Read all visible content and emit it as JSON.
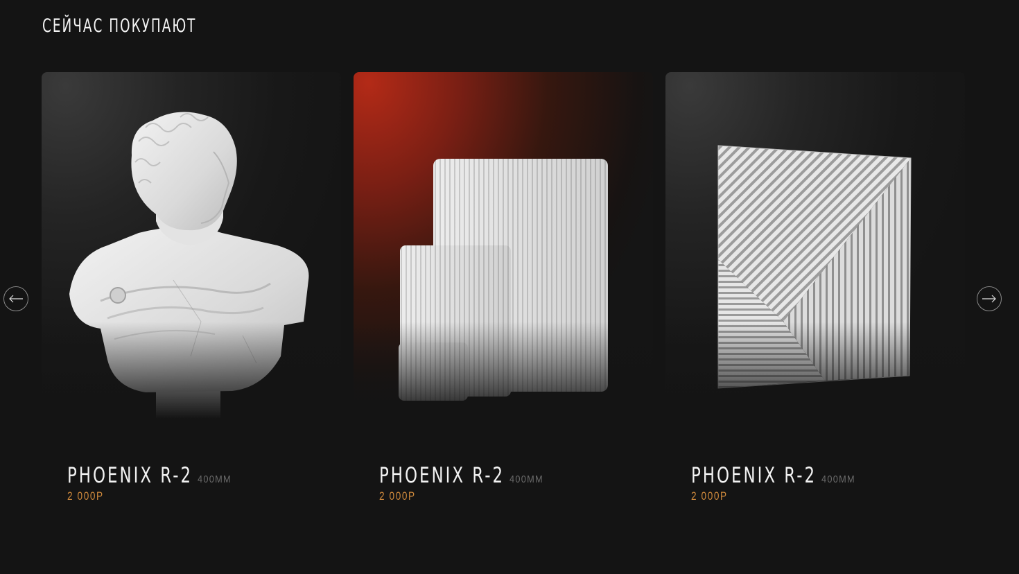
{
  "section": {
    "title": "СЕЙЧАС ПОКУПАЮТ"
  },
  "products": [
    {
      "name": "PHOENIX R-2",
      "size": "400MM",
      "price": "2 000P",
      "image": "marble-bust",
      "theme": "gray"
    },
    {
      "name": "PHOENIX R-2",
      "size": "400MM",
      "price": "2 000P",
      "image": "ribbed-vases",
      "theme": "red"
    },
    {
      "name": "PHOENIX R-2",
      "size": "400MM",
      "price": "2 000P",
      "image": "3d-wall-panel",
      "theme": "gray"
    }
  ],
  "nav": {
    "prev_icon": "arrow-left-icon",
    "next_icon": "arrow-right-icon"
  },
  "colors": {
    "background": "#141414",
    "price": "#d08a3c",
    "accent_red": "#b32a17",
    "muted": "#6b6b6b"
  }
}
